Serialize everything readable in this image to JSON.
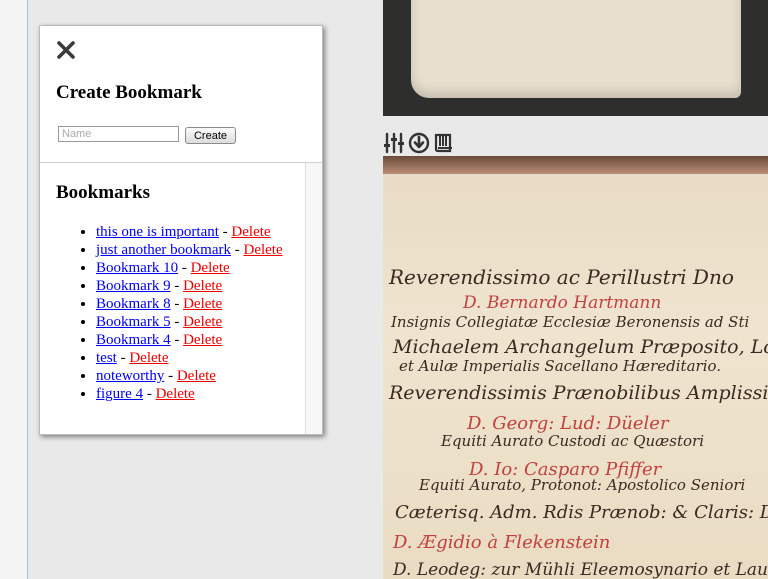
{
  "bookmark_panel": {
    "create_title": "Create Bookmark",
    "name_placeholder": "Name",
    "name_value": "",
    "create_button": "Create",
    "list_title": "Bookmarks",
    "delete_label": "Delete",
    "separator": " - ",
    "items": [
      {
        "label": "this one is important"
      },
      {
        "label": "just another bookmark"
      },
      {
        "label": "Bookmark 10"
      },
      {
        "label": "Bookmark 9"
      },
      {
        "label": "Bookmark 8"
      },
      {
        "label": "Bookmark 5"
      },
      {
        "label": "Bookmark 4"
      },
      {
        "label": "test"
      },
      {
        "label": "noteworthy"
      },
      {
        "label": "figure 4"
      }
    ]
  },
  "viewer_toolbar": {
    "icons": [
      "sliders-icon",
      "download-icon",
      "book-icon"
    ]
  },
  "manuscript": {
    "lines": [
      {
        "text": "Reverendissimo ac Perillustri Dno",
        "color": "#3a2a22"
      },
      {
        "text": "D. Bernardo Hartmann",
        "color": "#c0413f"
      },
      {
        "text": "Insignis Collegiatæ Ecclesiæ Beronensis ad Sti",
        "color": "#3a2a22"
      },
      {
        "text": "Michaelem Archangelum Præposito, Loci",
        "color": "#3a2a22"
      },
      {
        "text": "et Aulæ Imperialis Sacellano Hæreditario.",
        "color": "#3a2a22"
      },
      {
        "text": "Reverendissimis Prænobilibus Amplissimi",
        "color": "#3a2a22"
      },
      {
        "text": "D. Georg: Lud: Düeler",
        "color": "#c0413f"
      },
      {
        "text": "Equiti Aurato Custodi ac Quæstori",
        "color": "#3a2a22"
      },
      {
        "text": "D. Io: Casparo Pfiffer",
        "color": "#c0413f"
      },
      {
        "text": "Equiti Aurato, Protonot: Apostolico Seniori",
        "color": "#3a2a22"
      },
      {
        "text": "Cæterisq. Adm. Rdis Prænob: & Claris: D",
        "color": "#3a2a22"
      },
      {
        "text": "D. Ægidio à Flekenstein",
        "color": "#c0413f"
      },
      {
        "text": "D. Leodeg: zur Mühli Eleemosynario et Lauda",
        "color": "#3a2a22"
      }
    ]
  }
}
